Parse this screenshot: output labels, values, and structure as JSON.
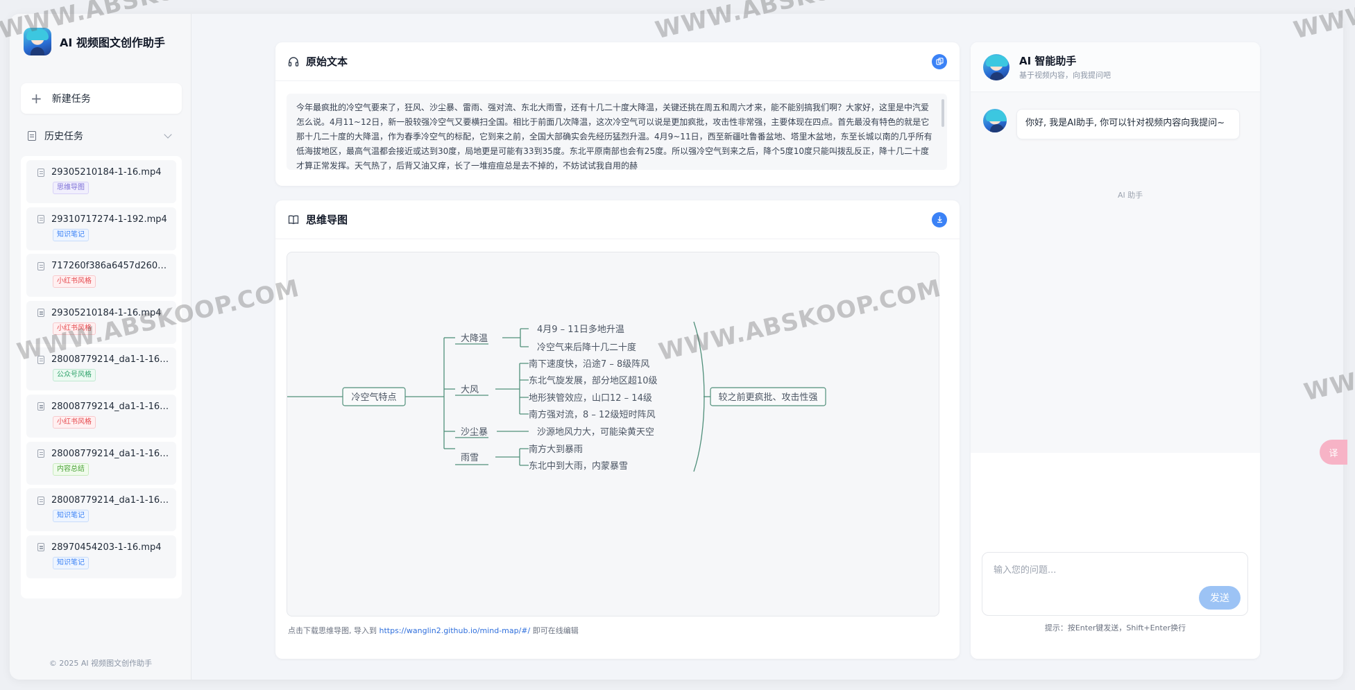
{
  "brand": {
    "title": "AI 视频图文创作助手"
  },
  "sidebar": {
    "new_task_label": "新建任务",
    "history_label": "历史任务",
    "items": [
      {
        "name": "29305210184-1-16.mp4",
        "tag": "思维导图",
        "tag_color": "#7c6fd6"
      },
      {
        "name": "29310717274-1-192.mp4",
        "tag": "知识笔记",
        "tag_color": "#3b82f6"
      },
      {
        "name": "717260f386a6457d260e...",
        "tag": "小红书风格",
        "tag_color": "#e5484d"
      },
      {
        "name": "29305210184-1-16.mp4",
        "tag": "小红书风格",
        "tag_color": "#e5484d"
      },
      {
        "name": "28008779214_da1-1-16....",
        "tag": "公众号风格",
        "tag_color": "#2fa36b"
      },
      {
        "name": "28008779214_da1-1-16....",
        "tag": "小红书风格",
        "tag_color": "#e5484d"
      },
      {
        "name": "28008779214_da1-1-16....",
        "tag": "内容总结",
        "tag_color": "#4ca33a"
      },
      {
        "name": "28008779214_da1-1-16....",
        "tag": "知识笔记",
        "tag_color": "#3b82f6"
      },
      {
        "name": "28970454203-1-16.mp4",
        "tag": "知识笔记",
        "tag_color": "#3b82f6"
      }
    ],
    "footer": "© 2025 AI 视频图文创作助手"
  },
  "original_text": {
    "title": "原始文本",
    "content": "今年最疯批的冷空气要来了，狂风、沙尘暴、雷雨、强对流、东北大雨雪，还有十几二十度大降温，关键还挑在周五和周六才来，能不能别搞我们啊？大家好，这里是中汽爱怎么说。4月11~12日，新一股较强冷空气又要横扫全国。相比于前面几次降温，这次冷空气可以说是更加疯批，攻击性非常强，主要体现在四点。首先最没有特色的就是它那十几二十度的大降温，作为春季冷空气的标配，它到来之前，全国大部确实会先经历猛烈升温。4月9~11日，西至新疆吐鲁番盆地、塔里木盆地，东至长城以南的几乎所有低海拔地区，最高气温都会接近或达到30度，局地更是可能有33到35度。东北平原南部也会有25度。所以强冷空气到来之后，降个5度10度只能叫拨乱反正，降十几二十度才算正常发挥。天气热了，后背又油又痒，长了一堆痘痘总是去不掉的，不妨试试我自用的赫"
  },
  "mind_map": {
    "title": "思维导图",
    "root": "冷空气特点",
    "branches": [
      {
        "label": "大降温",
        "children": [
          "4月9 – 11日多地升温",
          "冷空气来后降十几二十度"
        ]
      },
      {
        "label": "大风",
        "children": [
          "南下速度快，沿途7 – 8级阵风",
          "东北气旋发展，部分地区超10级",
          "地形狭管效应，山口12 – 14级",
          "南方强对流，8 – 12级短时阵风"
        ]
      },
      {
        "label": "沙尘暴",
        "children": [
          "沙源地风力大，可能染黄天空"
        ]
      },
      {
        "label": "雨雪",
        "children": [
          "南方大到暴雨",
          "东北中到大雨，内蒙暴雪"
        ]
      }
    ],
    "summary": "较之前更疯批、攻击性强",
    "note_prefix": "点击下载思维导图, 导入到",
    "note_link": "https://wanglin2.github.io/mind-map/#/",
    "note_suffix": "即可在线编辑"
  },
  "chat": {
    "title": "AI 智能助手",
    "subtitle": "基于视频内容，向我提问吧",
    "message": "你好, 我是AI助手, 你可以针对视频内容向我提问~",
    "sender": "AI 助手",
    "input_placeholder": "输入您的问题...",
    "send_label": "发送",
    "hint": "提示：按Enter键发送，Shift+Enter换行"
  },
  "float_button_label": "译",
  "watermark": "WWW.ABSKOOP.COM"
}
